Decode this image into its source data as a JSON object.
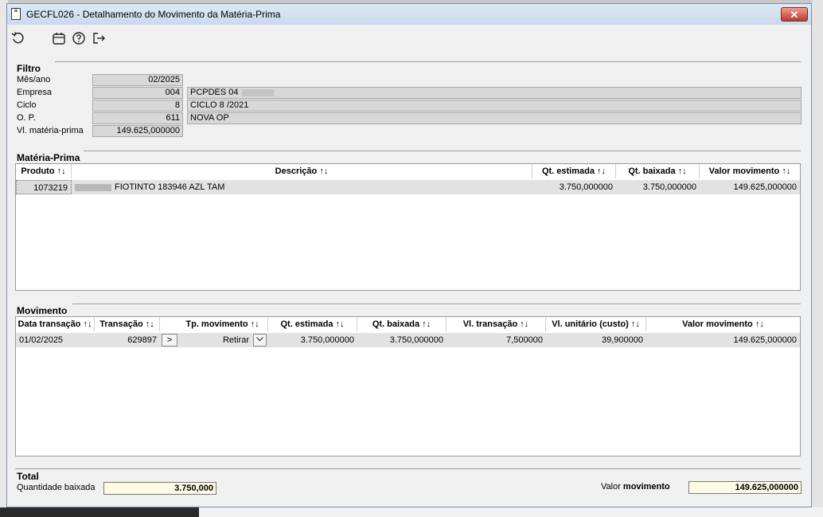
{
  "window": {
    "title": "GECFL026 - Detalhamento do Movimento da Matéria-Prima",
    "close_label": "✕"
  },
  "filtro": {
    "title": "Filtro",
    "mesano_label": "Mês/ano",
    "mesano_value": "02/2025",
    "empresa_label": "Empresa",
    "empresa_value": "004",
    "empresa_desc": "PCPDES 04",
    "ciclo_label": "Ciclo",
    "ciclo_value": "8",
    "ciclo_desc": "CICLO 8 /2021",
    "op_label": "O. P.",
    "op_value": "611",
    "op_desc": "NOVA OP",
    "vl_label": "Vl. matéria-prima",
    "vl_value": "149.625,000000"
  },
  "materia": {
    "title": "Matéria-Prima",
    "headers": [
      "Produto ↑↓",
      "Descrição ↑↓",
      "Qt. estimada ↑↓",
      "Qt. baixada ↑↓",
      "Valor movimento ↑↓"
    ],
    "rows": [
      {
        "produto": "1073219",
        "descricao": "FIOTINTO 183946 AZL TAM",
        "qt_estimada": "3.750,000000",
        "qt_baixada": "3.750,000000",
        "valor": "149.625,000000"
      }
    ]
  },
  "movimento": {
    "title": "Movimento",
    "headers": [
      "Data transação ↑↓",
      "Transação ↑↓",
      "Tp. movimento ↑↓",
      "Qt. estimada ↑↓",
      "Qt. baixada ↑↓",
      "Vl. transação ↑↓",
      "Vl. unitário (custo) ↑↓",
      "Valor movimento ↑↓"
    ],
    "rows": [
      {
        "data": "01/02/2025",
        "transacao": "629897",
        "btn": ">",
        "tipo": "Retirar",
        "qt_estimada": "3.750,000000",
        "qt_baixada": "3.750,000000",
        "vl_transacao": "7,500000",
        "vl_unitario": "39,900000",
        "valor": "149.625,000000"
      }
    ]
  },
  "total": {
    "title": "Total",
    "qtd_label": "Quantidade baixada",
    "qtd_value": "3.750,000",
    "valor_label_1": "Valor ",
    "valor_label_2": "movimento",
    "valor_value": "149.625,000000"
  }
}
